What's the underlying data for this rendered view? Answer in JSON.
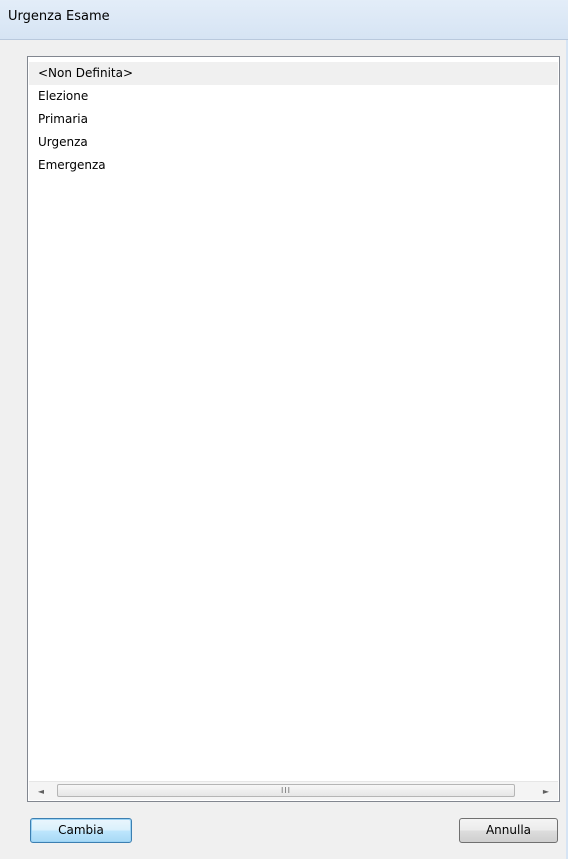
{
  "window": {
    "title": "Urgenza Esame"
  },
  "list": {
    "items": [
      "<Non Definita>",
      "Elezione",
      "Primaria",
      "Urgenza",
      "Emergenza"
    ],
    "selected_index": 0
  },
  "scrollbar": {
    "left_arrow": "◄",
    "right_arrow": "►",
    "grip": "III"
  },
  "buttons": {
    "change_label": "Cambia",
    "cancel_label": "Annulla"
  }
}
